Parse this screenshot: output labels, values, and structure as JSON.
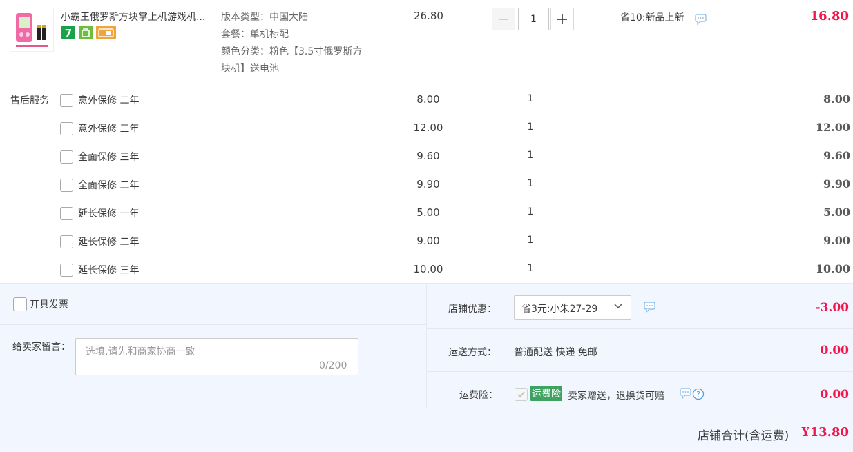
{
  "product": {
    "name": "小霸王俄罗斯方块掌上机游戏机...",
    "specs": [
      "版本类型：中国大陆",
      "套餐：单机标配",
      "颜色分类：粉色【3.5寸俄罗斯方",
      "块机】送电池"
    ],
    "unit_price": "26.80",
    "quantity": "1",
    "promo": "省10:新品上新",
    "subtotal": "16.80",
    "tags": [
      "7-day-return-icon",
      "bag-icon",
      "card-icon"
    ],
    "tag_colors": {
      "tag1": "#1aa24a",
      "tag2": "#6bbf3a",
      "tag3": "#f2a33a"
    }
  },
  "services": {
    "title": "售后服务",
    "items": [
      {
        "name": "意外保修  二年",
        "price": "8.00",
        "qty": "1",
        "subtotal": "8.00"
      },
      {
        "name": "意外保修  三年",
        "price": "12.00",
        "qty": "1",
        "subtotal": "12.00"
      },
      {
        "name": "全面保修  三年",
        "price": "9.60",
        "qty": "1",
        "subtotal": "9.60"
      },
      {
        "name": "全面保修  二年",
        "price": "9.90",
        "qty": "1",
        "subtotal": "9.90"
      },
      {
        "name": "延长保修  一年",
        "price": "5.00",
        "qty": "1",
        "subtotal": "5.00"
      },
      {
        "name": "延长保修  二年",
        "price": "9.00",
        "qty": "1",
        "subtotal": "9.00"
      },
      {
        "name": "延长保修  三年",
        "price": "10.00",
        "qty": "1",
        "subtotal": "10.00"
      }
    ]
  },
  "invoice": {
    "label": "开具发票"
  },
  "message": {
    "label": "给卖家留言：",
    "placeholder": "选填,请先和商家协商一致",
    "count": "0/200"
  },
  "shop_discount": {
    "label": "店铺优惠：",
    "selected": "省3元:小朱27-29",
    "amount": "-3.00"
  },
  "shipping": {
    "label": "运送方式：",
    "method": "普通配送 快递 免邮",
    "amount": "0.00"
  },
  "insurance": {
    "label": "运费险：",
    "badge": "运费险",
    "desc": "卖家赠送，退换货可赔",
    "amount": "0.00"
  },
  "total": {
    "label": "店铺合计(含运费)",
    "value": "¥13.80"
  },
  "colors": {
    "accent": "#f0154b",
    "panel_bg": "#f2f7ff",
    "insurance_green": "#3ea361"
  }
}
